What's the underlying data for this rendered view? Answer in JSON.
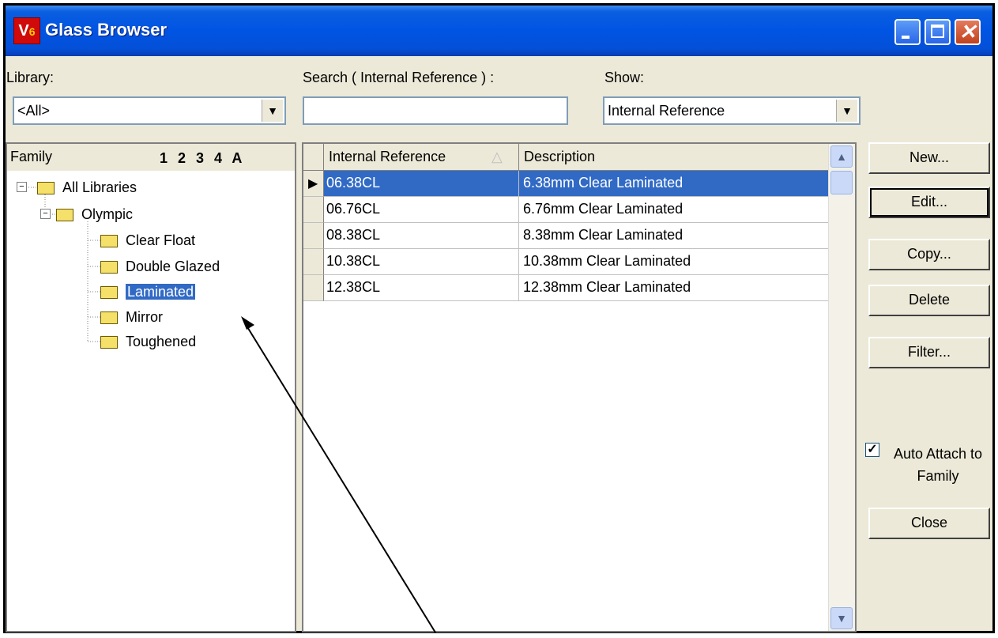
{
  "window": {
    "title": "Glass Browser",
    "app_icon": "V6"
  },
  "library": {
    "label": "Library:",
    "value": "<All>"
  },
  "search": {
    "label": "Search ( Internal Reference ) :",
    "value": ""
  },
  "show": {
    "label": "Show:",
    "value": "Internal Reference"
  },
  "family": {
    "label": "Family",
    "levels": "1 2 3 4 A",
    "tree": [
      {
        "label": "All Libraries"
      },
      {
        "label": "Olympic"
      },
      {
        "label": "Clear Float"
      },
      {
        "label": "Double Glazed"
      },
      {
        "label": "Laminated",
        "selected": true
      },
      {
        "label": "Mirror"
      },
      {
        "label": "Toughened"
      }
    ]
  },
  "grid": {
    "columns": [
      "Internal Reference",
      "Description"
    ],
    "rows": [
      {
        "ref": "06.38CL",
        "desc": "6.38mm Clear Laminated",
        "selected": true
      },
      {
        "ref": "06.76CL",
        "desc": "6.76mm Clear Laminated"
      },
      {
        "ref": "08.38CL",
        "desc": "8.38mm Clear Laminated"
      },
      {
        "ref": "10.38CL",
        "desc": "10.38mm Clear Laminated"
      },
      {
        "ref": "12.38CL",
        "desc": "12.38mm Clear Laminated"
      }
    ]
  },
  "buttons": {
    "new": "New...",
    "edit": "Edit...",
    "copy": "Copy...",
    "delete": "Delete",
    "filter": "Filter...",
    "close": "Close"
  },
  "auto_attach": {
    "label": "Auto Attach to Family",
    "checked": true
  }
}
